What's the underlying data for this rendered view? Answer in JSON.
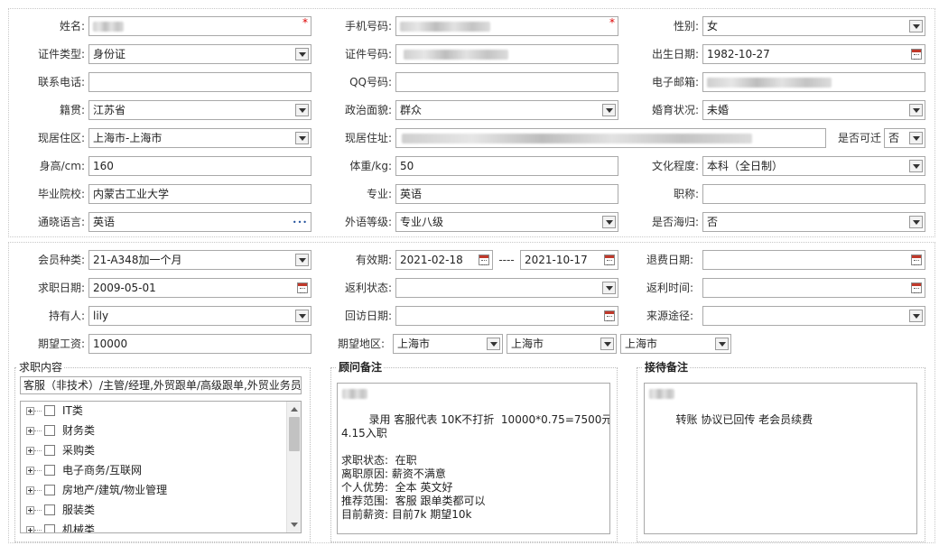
{
  "basic": {
    "name_label": "姓名:",
    "mobile_label": "手机号码:",
    "gender_label": "性别:",
    "gender_value": "女",
    "id_type_label": "证件类型:",
    "id_type_value": "身份证",
    "id_no_label": "证件号码:",
    "birth_label": "出生日期:",
    "birth_value": "1982-10-27",
    "phone_label": "联系电话:",
    "qq_label": "QQ号码:",
    "email_label": "电子邮箱:",
    "origin_label": "籍贯:",
    "origin_value": "江苏省",
    "politics_label": "政治面貌:",
    "politics_value": "群众",
    "marital_label": "婚育状况:",
    "marital_value": "未婚",
    "region_label": "现居住区:",
    "region_value": "上海市-上海市",
    "address_label": "现居住址:",
    "relocate_label": "是否可迁",
    "relocate_value": "否",
    "height_label": "身高/cm:",
    "height_value": "160",
    "weight_label": "体重/kg:",
    "weight_value": "50",
    "education_label": "文化程度:",
    "education_value": "本科（全日制）",
    "school_label": "毕业院校:",
    "school_value": "内蒙古工业大学",
    "major_label": "专业:",
    "major_value": "英语",
    "title_label": "职称:",
    "language_label": "通晓语言:",
    "language_value": "英语",
    "lang_level_label": "外语等级:",
    "lang_level_value": "专业八级",
    "overseas_label": "是否海归:",
    "overseas_value": "否",
    "required_mark": "*",
    "more_dots": "•••"
  },
  "membership": {
    "type_label": "会员种类:",
    "type_value": "21-A348加一个月",
    "validity_label": "有效期:",
    "validity_start": "2021-02-18",
    "validity_sep": "----",
    "validity_end": "2021-10-17",
    "refund_date_label": "退费日期:",
    "job_date_label": "求职日期:",
    "job_date_value": "2009-05-01",
    "rebate_status_label": "返利状态:",
    "rebate_time_label": "返利时间:",
    "holder_label": "持有人:",
    "holder_value": "lily",
    "visit_date_label": "回访日期:",
    "source_label": "来源途径:",
    "salary_label": "期望工资:",
    "salary_value": "10000",
    "area_label": "期望地区:",
    "area_values": [
      "上海市",
      "上海市",
      "上海市"
    ]
  },
  "job_content": {
    "title": "求职内容",
    "selected": "客服（非技术）/主管/经理,外贸跟单/高级跟单,外贸业务员",
    "categories": [
      "IT类",
      "财务类",
      "采购类",
      "电子商务/互联网",
      "房地产/建筑/物业管理",
      "服装类",
      "机械类"
    ]
  },
  "consultant_notes": {
    "title": "顾问备注",
    "text": "      录用 客服代表 10K不打折  10000*0.75=7500元\n4.15入职\n\n求职状态:  在职\n离职原因: 薪资不满意\n个人优势:  全本 英文好\n推荐范围:  客服 跟单类都可以\n目前薪资: 目前7k 期望10k"
  },
  "reception_notes": {
    "title": "接待备注",
    "text": "      转账 协议已回传 老会员续费"
  }
}
